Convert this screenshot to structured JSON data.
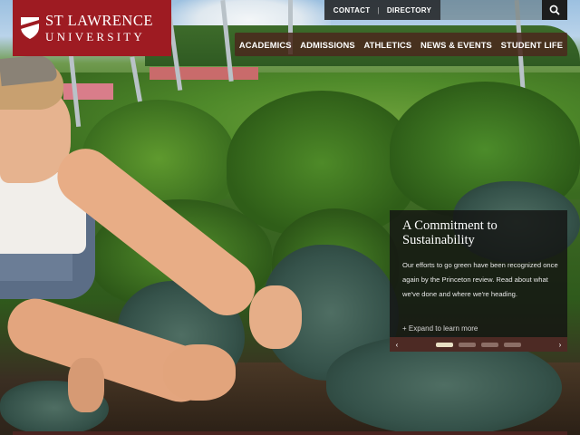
{
  "brand": {
    "line1": "ST LAWRENCE",
    "line2": "UNIVERSITY",
    "color": "#9e1b22"
  },
  "utility_nav": {
    "contact": "CONTACT",
    "separator": "|",
    "directory": "DIRECTORY",
    "search_placeholder": ""
  },
  "main_nav": {
    "items": [
      "ACADEMICS",
      "ADMISSIONS",
      "ATHLETICS",
      "NEWS & EVENTS",
      "STUDENT LIFE"
    ]
  },
  "feature": {
    "title": "A Commitment to Sustainability",
    "body": "Our efforts to go green have been recognized once again by the Princeton review. Read about what we've done and where we're heading.",
    "link": "+ Expand to learn more"
  },
  "slider": {
    "prev": "‹",
    "next": "›",
    "slide_count": 4,
    "active_index": 0
  },
  "icons": {
    "search": "search-icon",
    "shield": "shield-icon"
  }
}
